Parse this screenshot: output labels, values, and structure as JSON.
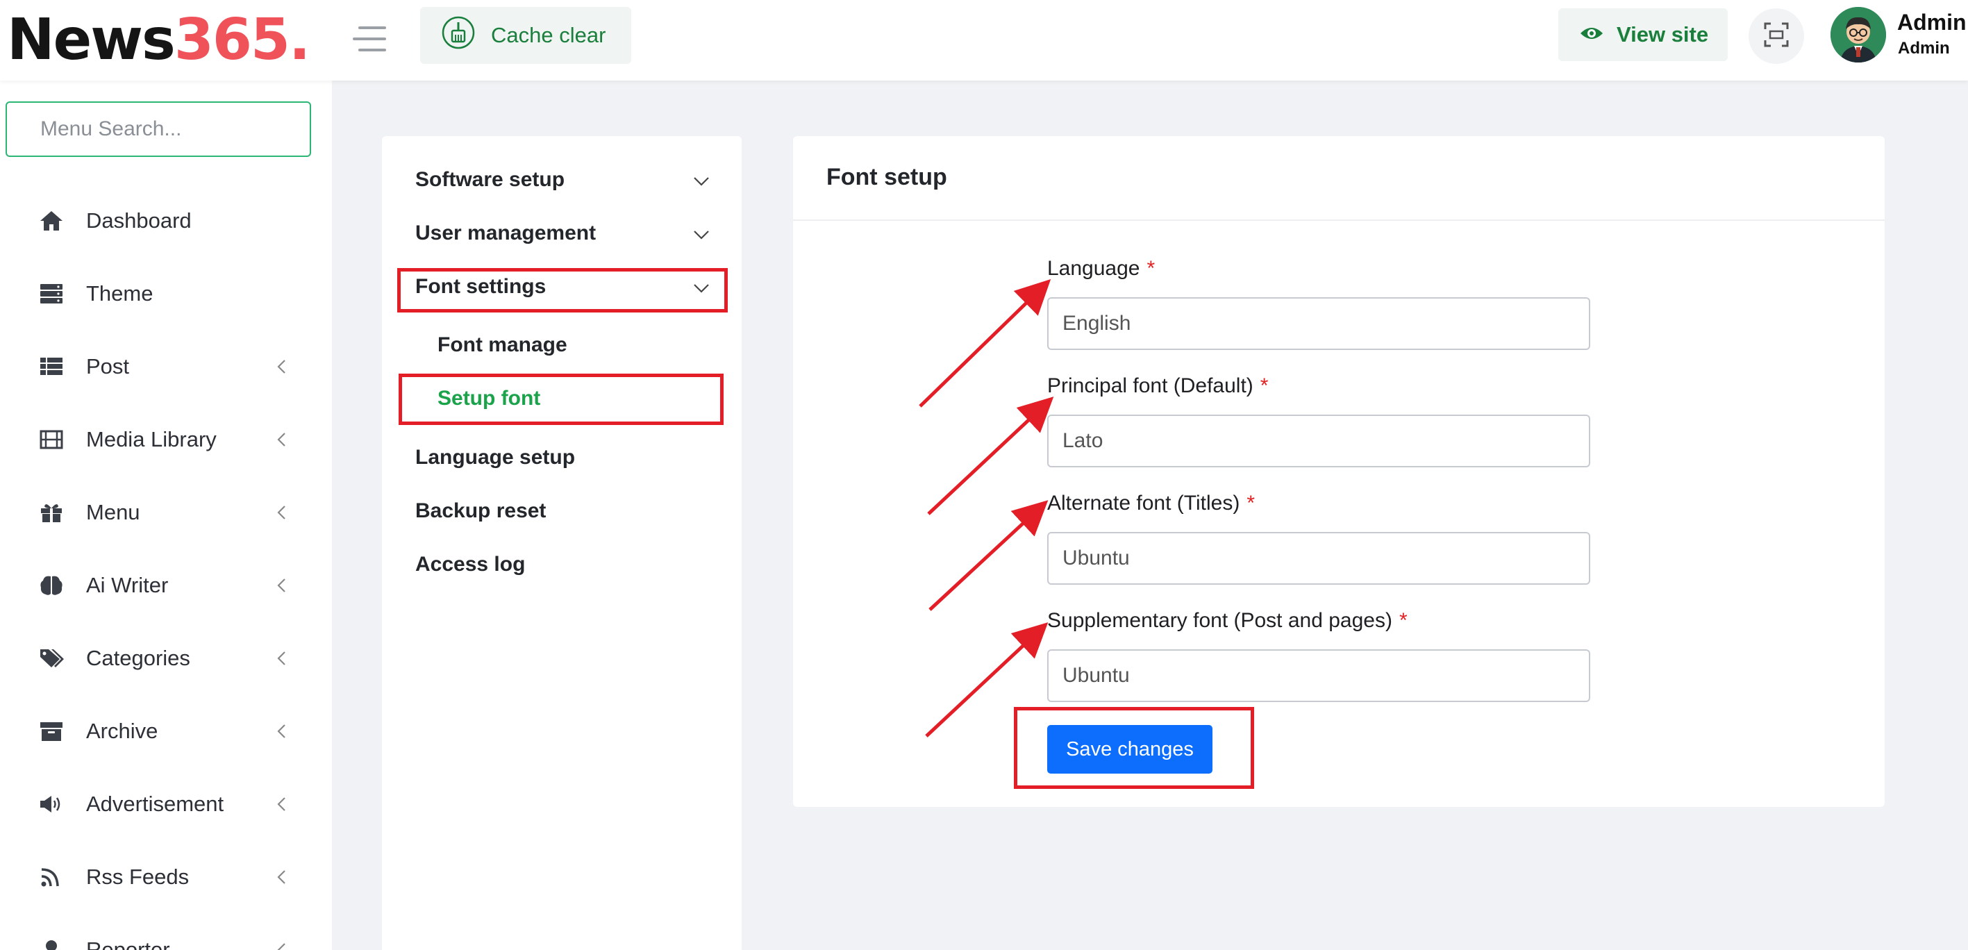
{
  "brand": {
    "part1": "News",
    "part2": "365."
  },
  "topbar": {
    "cache_clear": "Cache clear",
    "view_site": "View site",
    "user_name": "Admin",
    "user_role": "Admin"
  },
  "sidebar": {
    "search_placeholder": "Menu Search...",
    "items": [
      {
        "label": "Dashboard",
        "icon": "home-icon"
      },
      {
        "label": "Theme",
        "icon": "server-icon"
      },
      {
        "label": "Post",
        "icon": "list-icon"
      },
      {
        "label": "Media Library",
        "icon": "film-icon"
      },
      {
        "label": "Menu",
        "icon": "gift-icon"
      },
      {
        "label": "Ai Writer",
        "icon": "brain-icon"
      },
      {
        "label": "Categories",
        "icon": "tags-icon"
      },
      {
        "label": "Archive",
        "icon": "archive-icon"
      },
      {
        "label": "Advertisement",
        "icon": "megaphone-icon"
      },
      {
        "label": "Rss Feeds",
        "icon": "rss-icon"
      },
      {
        "label": "Reporter",
        "icon": "user-icon"
      }
    ]
  },
  "settings_menu": {
    "software_setup": "Software setup",
    "user_management": "User management",
    "font_settings": "Font settings",
    "font_manage": "Font manage",
    "setup_font": "Setup font",
    "language_setup": "Language setup",
    "backup_reset": "Backup reset",
    "access_log": "Access log"
  },
  "font_setup": {
    "title": "Font setup",
    "required_mark": "*",
    "fields": [
      {
        "label": "Language",
        "value": "English"
      },
      {
        "label": "Principal font (Default)",
        "value": "Lato"
      },
      {
        "label": "Alternate font (Titles)",
        "value": "Ubuntu"
      },
      {
        "label": "Supplementary font (Post and pages)",
        "value": "Ubuntu"
      }
    ],
    "save_label": "Save changes"
  },
  "colors": {
    "brand_accent": "#f0525a",
    "primary_button": "#0d6efd",
    "active_green": "#1aa34a",
    "annotation_red": "#e41e26"
  }
}
